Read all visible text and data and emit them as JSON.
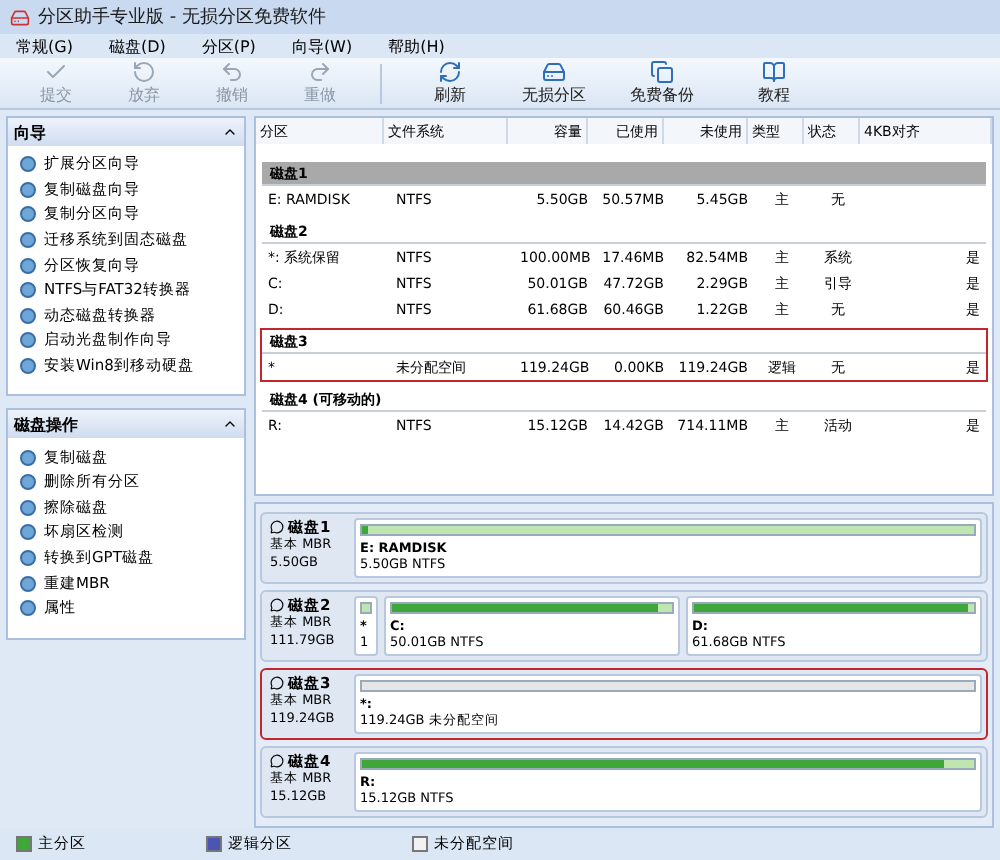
{
  "window": {
    "title": "分区助手专业版 - 无损分区免费软件"
  },
  "menu": [
    "常规(G)",
    "磁盘(D)",
    "分区(P)",
    "向导(W)",
    "帮助(H)"
  ],
  "toolbar": [
    {
      "label": "提交",
      "disabled": true
    },
    {
      "label": "放弃",
      "disabled": true
    },
    {
      "label": "撤销",
      "disabled": true
    },
    {
      "label": "重做",
      "disabled": true
    },
    {
      "label": "刷新",
      "disabled": false
    },
    {
      "label": "无损分区",
      "disabled": false
    },
    {
      "label": "免费备份",
      "disabled": false
    },
    {
      "label": "教程",
      "disabled": false
    }
  ],
  "sidebar": [
    {
      "title": "向导",
      "expanded": true,
      "items": [
        "扩展分区向导",
        "复制磁盘向导",
        "复制分区向导",
        "迁移系统到固态磁盘",
        "分区恢复向导",
        "NTFS与FAT32转换器",
        "动态磁盘转换器",
        "启动光盘制作向导",
        "安装Win8到移动硬盘"
      ]
    },
    {
      "title": "磁盘操作",
      "expanded": true,
      "items": [
        "复制磁盘",
        "删除所有分区",
        "擦除磁盘",
        "坏扇区检测",
        "转换到GPT磁盘",
        "重建MBR",
        "属性"
      ]
    }
  ],
  "table": {
    "columns": [
      "分区",
      "文件系统",
      "容量",
      "已使用",
      "未使用",
      "类型",
      "状态",
      "4KB对齐"
    ],
    "groups": [
      {
        "name": "磁盘1",
        "selected": true,
        "highlighted": false,
        "rows": [
          [
            "E: RAMDISK",
            "NTFS",
            "5.50GB",
            "50.57MB",
            "5.45GB",
            "主",
            "无",
            ""
          ]
        ]
      },
      {
        "name": "磁盘2",
        "selected": false,
        "highlighted": false,
        "rows": [
          [
            "*: 系统保留",
            "NTFS",
            "100.00MB",
            "17.46MB",
            "82.54MB",
            "主",
            "系统",
            "是"
          ],
          [
            "C:",
            "NTFS",
            "50.01GB",
            "47.72GB",
            "2.29GB",
            "主",
            "引导",
            "是"
          ],
          [
            "D:",
            "NTFS",
            "61.68GB",
            "60.46GB",
            "1.22GB",
            "主",
            "无",
            "是"
          ]
        ]
      },
      {
        "name": "磁盘3",
        "selected": false,
        "highlighted": true,
        "rows": [
          [
            "*",
            "未分配空间",
            "119.24GB",
            "0.00KB",
            "119.24GB",
            "逻辑",
            "无",
            "是"
          ]
        ]
      },
      {
        "name": "磁盘4 (可移动的)",
        "selected": false,
        "highlighted": false,
        "rows": [
          [
            "R:",
            "NTFS",
            "15.12GB",
            "14.42GB",
            "714.11MB",
            "主",
            "活动",
            "是"
          ]
        ]
      }
    ]
  },
  "disk_map": [
    {
      "name": "磁盘1",
      "type": "基本 MBR",
      "size": "5.50GB",
      "highlighted": false,
      "partitions": [
        {
          "kind": "primary",
          "label": "E: RAMDISK",
          "info": "5.50GB NTFS",
          "level": 0.01
        }
      ]
    },
    {
      "name": "磁盘2",
      "type": "基本 MBR",
      "size": "111.79GB",
      "highlighted": false,
      "partitions": [
        {
          "kind": "small",
          "label": "*",
          "info": "1"
        },
        {
          "kind": "primary",
          "label": "C:",
          "info": "50.01GB NTFS",
          "level": 0.95
        },
        {
          "kind": "primary",
          "label": "D:",
          "info": "61.68GB NTFS",
          "level": 0.98
        }
      ]
    },
    {
      "name": "磁盘3",
      "type": "基本 MBR",
      "size": "119.24GB",
      "highlighted": true,
      "partitions": [
        {
          "kind": "unallocated",
          "label": "*:",
          "info": "119.24GB 未分配空间"
        }
      ]
    },
    {
      "name": "磁盘4",
      "type": "基本 MBR",
      "size": "15.12GB",
      "highlighted": false,
      "partitions": [
        {
          "kind": "primary",
          "label": "R:",
          "info": "15.12GB NTFS",
          "level": 0.95
        }
      ]
    }
  ],
  "legend": [
    {
      "kind": "primary",
      "label": "主分区"
    },
    {
      "kind": "logical",
      "label": "逻辑分区"
    },
    {
      "kind": "unallocated",
      "label": "未分配空间"
    }
  ]
}
